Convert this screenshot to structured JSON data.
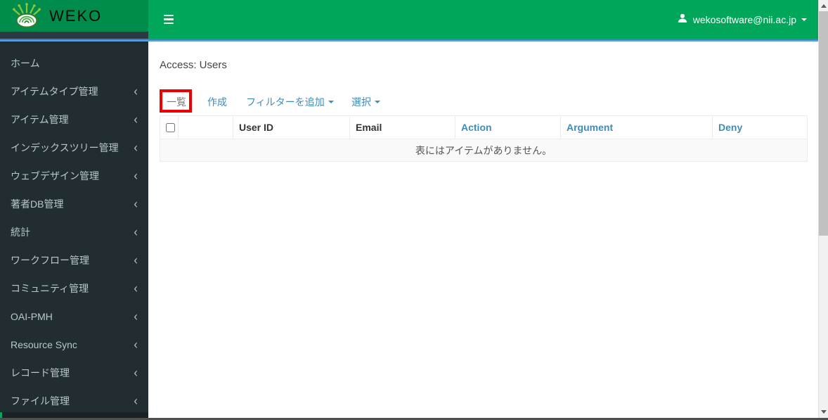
{
  "app": {
    "brand": "WEKO"
  },
  "navbar": {
    "user_email": "wekosoftware@nii.ac.jp",
    "icons": [
      "hamburger-icon",
      "user-icon",
      "caret-down-icon"
    ]
  },
  "sidebar": {
    "items": [
      {
        "label": "ホーム",
        "has_submenu": false
      },
      {
        "label": "アイテムタイプ管理",
        "has_submenu": true
      },
      {
        "label": "アイテム管理",
        "has_submenu": true
      },
      {
        "label": "インデックスツリー管理",
        "has_submenu": true
      },
      {
        "label": "ウェブデザイン管理",
        "has_submenu": true
      },
      {
        "label": "著者DB管理",
        "has_submenu": true
      },
      {
        "label": "統計",
        "has_submenu": true
      },
      {
        "label": "ワークフロー管理",
        "has_submenu": true
      },
      {
        "label": "コミュニティ管理",
        "has_submenu": true
      },
      {
        "label": "OAI-PMH",
        "has_submenu": true
      },
      {
        "label": "Resource Sync",
        "has_submenu": true
      },
      {
        "label": "レコード管理",
        "has_submenu": true
      },
      {
        "label": "ファイル管理",
        "has_submenu": true
      }
    ]
  },
  "main": {
    "page_title": "Access: Users",
    "tabs": [
      {
        "label": "一覧",
        "active": true,
        "dropdown": false
      },
      {
        "label": "作成",
        "active": false,
        "dropdown": false
      },
      {
        "label": "フィルターを追加",
        "active": false,
        "dropdown": true
      },
      {
        "label": "選択",
        "active": false,
        "dropdown": true
      }
    ],
    "table": {
      "headers": [
        {
          "label": "User ID",
          "sortable": false
        },
        {
          "label": "Email",
          "sortable": false
        },
        {
          "label": "Action",
          "sortable": true
        },
        {
          "label": "Argument",
          "sortable": true
        },
        {
          "label": "Deny",
          "sortable": true
        }
      ],
      "empty_message": "表にはアイテムがありません。"
    },
    "annotation": {
      "shape": "rectangle",
      "color": "#ee0000",
      "highlights": "一覧"
    }
  },
  "colors": {
    "navbar_green": "#00a65a",
    "logo_green": "#008d4c",
    "sidebar_bg": "#222d32",
    "sidebar_text": "#b8c7ce",
    "accent_blue_line": "#4a90d2",
    "link_blue": "#3c8dbc",
    "annotation_red": "#ee0000"
  }
}
